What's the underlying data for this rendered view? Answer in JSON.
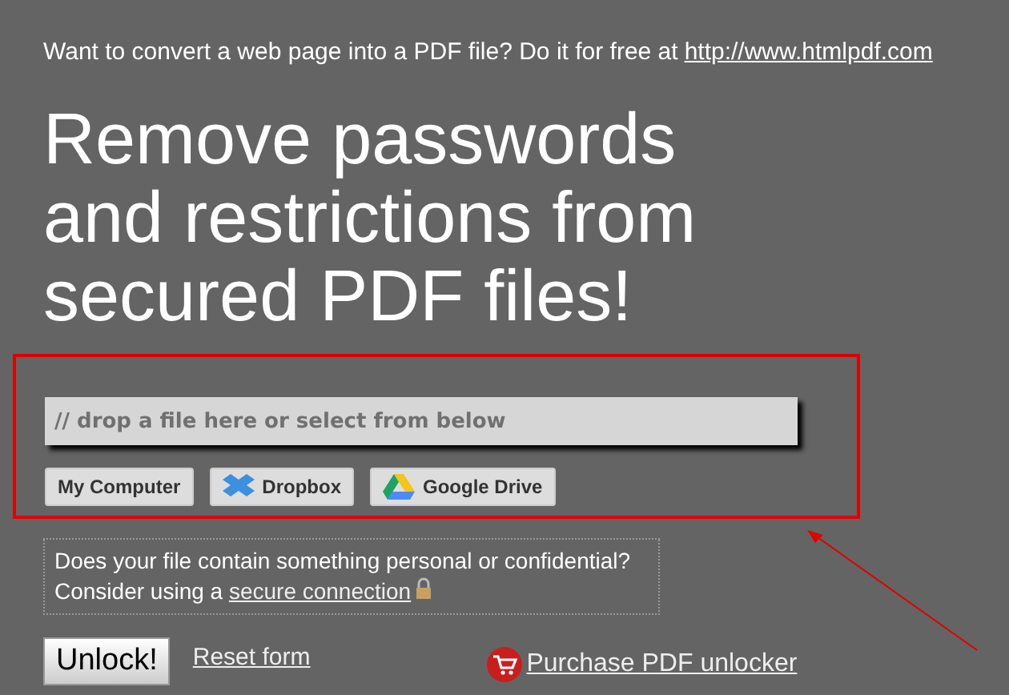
{
  "promo": {
    "text": "Want to convert a web page into a PDF file? Do it for free at",
    "link": "http://www.htmlpdf.com"
  },
  "headline": "Remove passwords and restrictions from secured PDF files!",
  "upload": {
    "placeholder": "// drop a file here or select from below",
    "sources": [
      {
        "kind": "computer",
        "label": "My Computer"
      },
      {
        "kind": "dropbox",
        "label": "Dropbox"
      },
      {
        "kind": "drive",
        "label": "Google Drive"
      }
    ]
  },
  "notice": {
    "line1": "Does your file contain something personal or confidential?",
    "line2": "Consider using a",
    "link": "secure connection"
  },
  "actions": {
    "unlock": "Unlock!",
    "reset": "Reset form",
    "purchase": "Purchase PDF unlocker"
  }
}
